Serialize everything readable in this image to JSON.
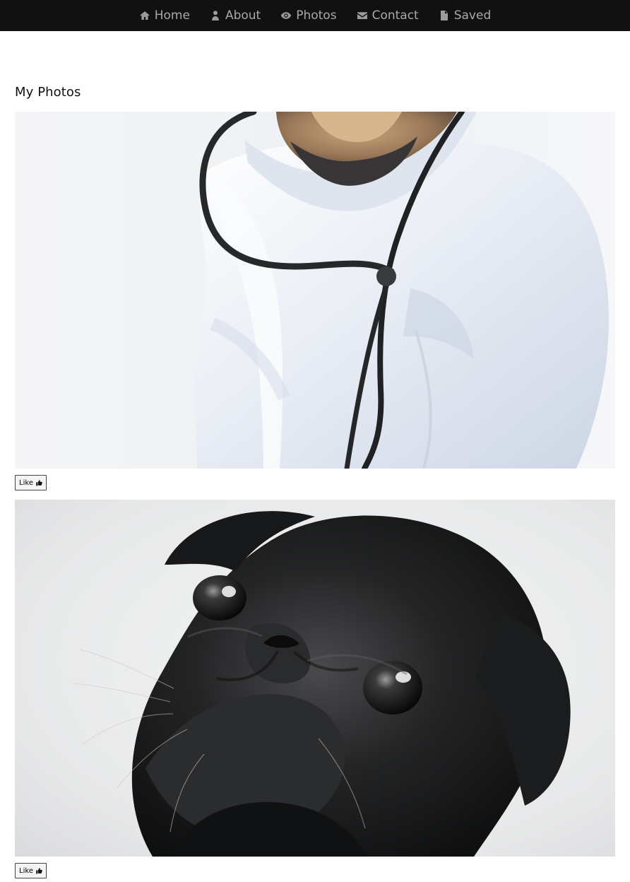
{
  "nav": {
    "items": [
      {
        "label": "Home",
        "icon": "home-icon"
      },
      {
        "label": "About",
        "icon": "user-icon"
      },
      {
        "label": "Photos",
        "icon": "eye-icon"
      },
      {
        "label": "Contact",
        "icon": "envelope-icon"
      },
      {
        "label": "Saved",
        "icon": "file-icon"
      }
    ]
  },
  "page": {
    "title": "My Photos"
  },
  "photos": [
    {
      "alt": "Dog wearing a white doctor's coat and stethoscope",
      "like_label": "Like",
      "icon": "thumbs-up-icon"
    },
    {
      "alt": "Black pug looking up",
      "like_label": "Like",
      "icon": "thumbs-up-icon"
    }
  ],
  "colors": {
    "nav_background": "#111111",
    "nav_text": "#a9a9a9",
    "page_background": "#ffffff"
  }
}
